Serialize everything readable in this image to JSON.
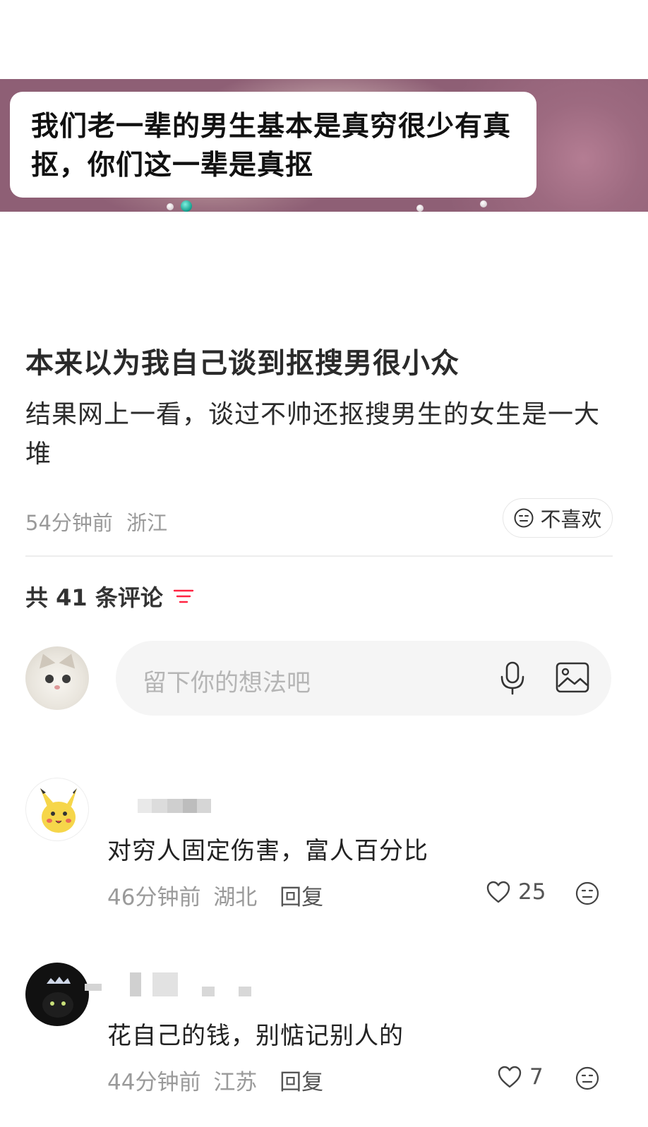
{
  "banner": {
    "quote": "我们老一辈的男生基本是真穷很少有真抠，你们这一辈是真抠"
  },
  "post": {
    "title": "本来以为我自己谈到抠搜男很小众",
    "body": "结果网上一看，谈过不帅还抠搜男生的女生是一大堆",
    "time": "54分钟前",
    "location": "浙江",
    "dislike_label": "不喜欢"
  },
  "comments_header": {
    "prefix": "共",
    "count": "41",
    "suffix": "条评论"
  },
  "input": {
    "placeholder": "留下你的想法吧"
  },
  "comments": [
    {
      "text": "对穷人固定伤害，富人百分比",
      "time": "46分钟前",
      "location": "湖北",
      "reply_label": "回复",
      "likes": "25"
    },
    {
      "text": "花自己的钱，别惦记别人的",
      "time": "44分钟前",
      "location": "江苏",
      "reply_label": "回复",
      "likes": "7"
    }
  ],
  "colors": {
    "accent_sort": "#ff2442",
    "muted_text": "#9a9a9a",
    "input_bg": "#f5f5f5"
  },
  "icons": [
    "face-neutral-icon",
    "sort-icon",
    "mic-icon",
    "image-icon",
    "heart-icon"
  ]
}
